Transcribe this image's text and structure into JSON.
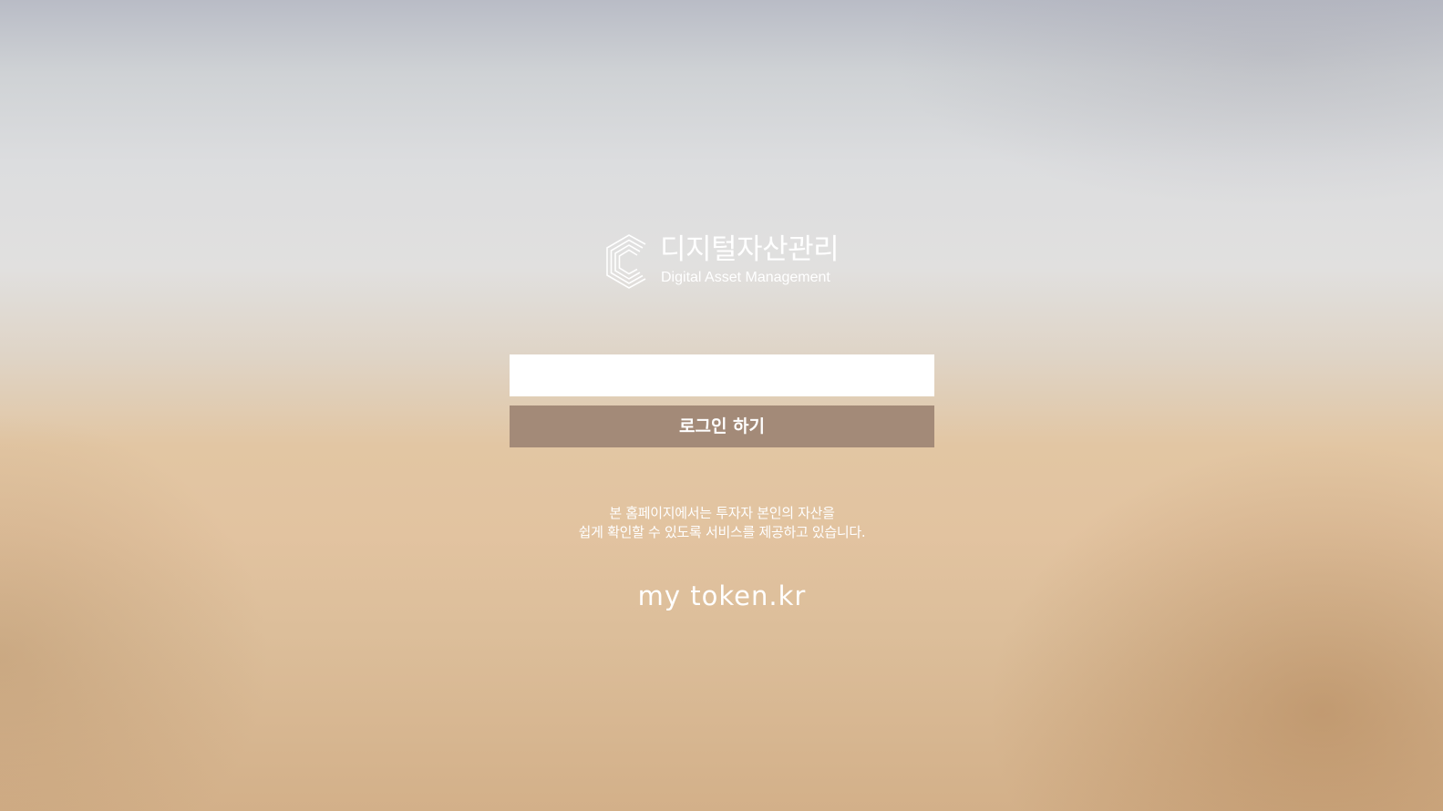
{
  "logo": {
    "title": "디지털자산관리",
    "subtitle": "Digital Asset Management",
    "mark_icon": "hexagon-c-logo-icon"
  },
  "login": {
    "input_value": "",
    "input_placeholder": "",
    "button_label": "로그인 하기",
    "button_color": "#a38a78"
  },
  "notice": {
    "line1": "본 홈페이지에서는 투자자 본인의 자산을",
    "line2": "쉽게 확인할 수 있도록 서비스를 제공하고 있습니다."
  },
  "brand": {
    "text": "my token.kr"
  }
}
